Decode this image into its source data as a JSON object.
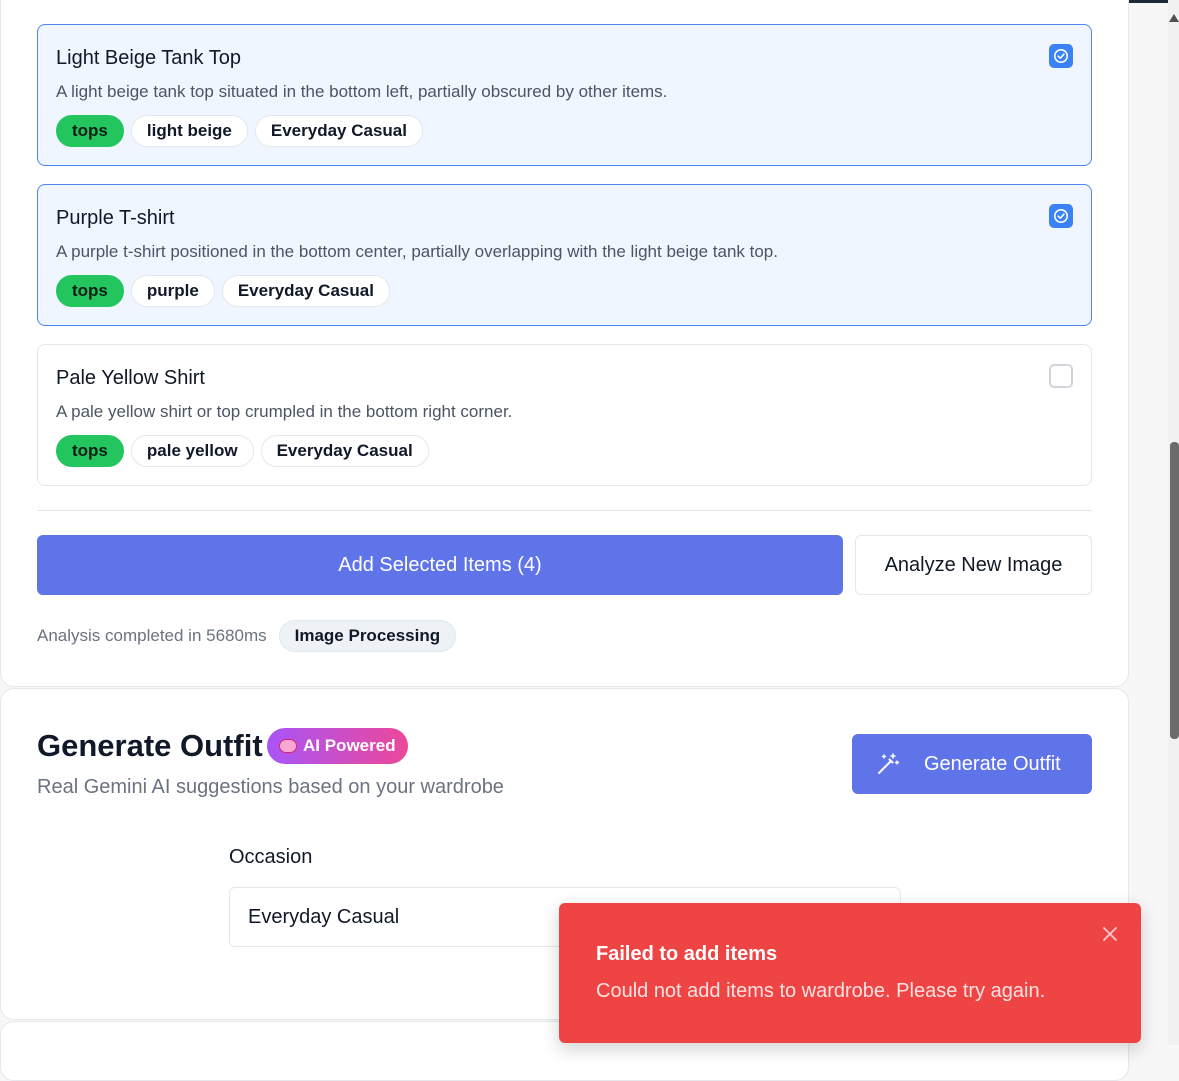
{
  "items": [
    {
      "title": "Light Beige Tank Top",
      "description": "A light beige tank top situated in the bottom left, partially obscured by other items.",
      "selected": true,
      "tags": {
        "category": "tops",
        "color": "light beige",
        "style": "Everyday Casual"
      }
    },
    {
      "title": "Purple T-shirt",
      "description": "A purple t-shirt positioned in the bottom center, partially overlapping with the light beige tank top.",
      "selected": true,
      "tags": {
        "category": "tops",
        "color": "purple",
        "style": "Everyday Casual"
      }
    },
    {
      "title": "Pale Yellow Shirt",
      "description": "A pale yellow shirt or top crumpled in the bottom right corner.",
      "selected": false,
      "tags": {
        "category": "tops",
        "color": "pale yellow",
        "style": "Everyday Casual"
      }
    }
  ],
  "actions": {
    "add_selected_label": "Add Selected Items (4)",
    "analyze_new_label": "Analyze New Image"
  },
  "analysis_meta": {
    "time_text": "Analysis completed in 5680ms",
    "badge": "Image Processing"
  },
  "generate": {
    "title": "Generate Outfit",
    "badge": "AI Powered",
    "subtitle": "Real Gemini AI suggestions based on your wardrobe",
    "button_label": "Generate Outfit",
    "occasion_label": "Occasion",
    "occasion_value": "Everyday Casual"
  },
  "toast": {
    "title": "Failed to add items",
    "message": "Could not add items to wardrobe. Please try again."
  },
  "colors": {
    "accent": "#6074ea",
    "selected_bg": "#eff6ff",
    "selected_border": "#4f86f7",
    "category_tag": "#22c55e",
    "error": "#ef4444"
  },
  "icons": {
    "checkbox_checked": "check-circle-icon",
    "generate": "magic-wand-icon",
    "ai_badge": "brain-icon",
    "toast_close": "close-icon"
  }
}
